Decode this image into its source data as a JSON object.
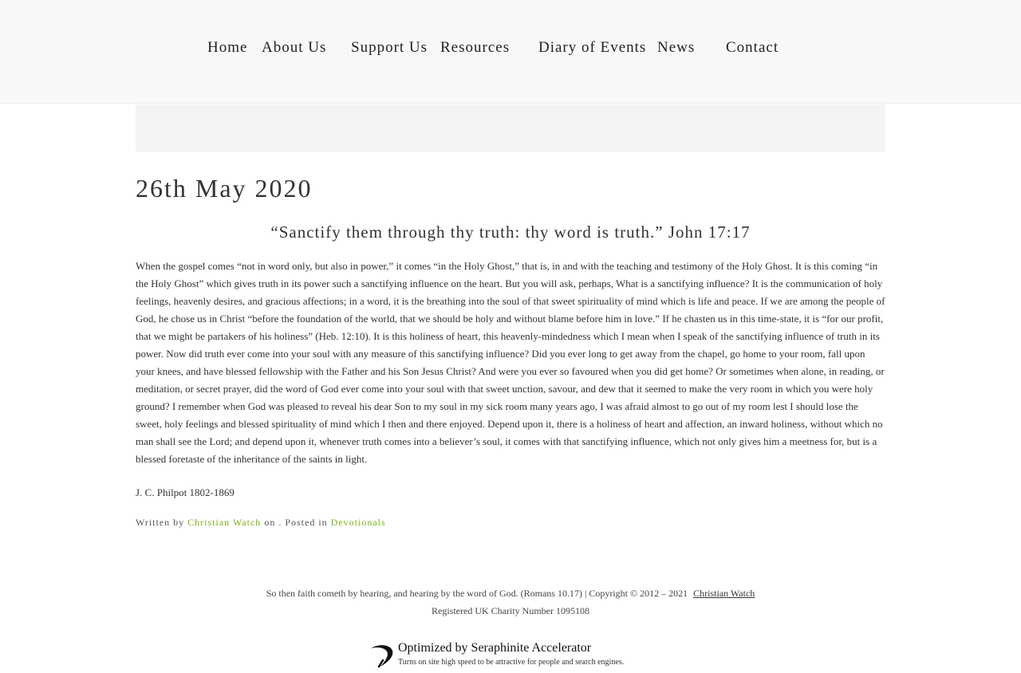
{
  "nav": {
    "items": [
      {
        "label": "Home"
      },
      {
        "label": "About Us"
      },
      {
        "label": "Support Us"
      },
      {
        "label": "Resources"
      },
      {
        "label": "Diary of Events"
      },
      {
        "label": "News"
      },
      {
        "label": "Contact"
      }
    ]
  },
  "post": {
    "date_title": "26th May 2020",
    "scripture": "“Sanctify them through thy truth: thy word is truth.” John 17:17",
    "body": "When the gospel comes “not in word only, but also in power,” it comes “in the Holy Ghost,” that is, in and with the teaching and testimony of the Holy Ghost. It is this coming “in the Holy Ghost” which gives truth in its power such a sanctifying influence on the heart. But you will ask, perhaps, What is a sanctifying influence? It is the communication of holy feelings, heavenly desires, and gracious affections; in a word, it is the breathing into the soul of that sweet spirituality of mind which is life and peace. If we are among the people of God, he chose us in Christ “before the foundation of the world, that we should be holy and without blame before him in love.” If he chasten us in this time-state, it is “for our profit, that we might be partakers of his holiness” (Heb. 12:10). It is this holiness of heart, this heavenly-mindedness which I mean when I speak of the sanctifying influence of truth in its power. Now did truth ever come into your soul with any measure of this sanctifying influence? Did you ever long to get away from the chapel, go home to your room, fall upon your knees, and have blessed fellowship with the Father and his Son Jesus Christ? And were you ever so favoured when you did get home? Or sometimes when alone, in reading, or meditation, or secret prayer, did the word of God ever come into your soul with that sweet unction, savour, and dew that it seemed to make the very room in which you were holy ground? I remember when God was pleased to reveal his dear Son to my soul in my sick room many years ago, I was afraid almost to go out of my room lest I should lose the sweet, holy feelings and blessed spirituality of mind which I then and there enjoyed. Depend upon it, there is a holiness of heart and affection, an inward holiness, without which no man shall see the Lord; and depend upon it, whenever truth comes into a believer’s soul, it comes with that sanctifying influence, which not only gives him a meetness for, but is a blessed foretaste of the inheritance of the saints in light.",
    "author": "J. C. Philpot 1802-1869",
    "meta": {
      "written_by": "Written by",
      "author_link": "Christian Watch",
      "posted_in_text": "on . Posted in",
      "category_link": "Devotionals"
    }
  },
  "footer": {
    "verse_copyright": "So then faith cometh by hearing, and hearing by the word of God. (Romans 10.17) | Copyright © 2012 – 2021",
    "copyright_link": "Christian Watch",
    "charity": "Registered UK Charity Number 1095108"
  },
  "badge": {
    "icon": "seraphinite-swoosh-icon",
    "title": "Optimized by Seraphinite Accelerator",
    "subtitle": "Turns on site high speed to be attractive for people and search engines."
  },
  "colors": {
    "topbar_bg": "#f8f8fa",
    "link_green": "#7ab317",
    "text": "#333333"
  }
}
